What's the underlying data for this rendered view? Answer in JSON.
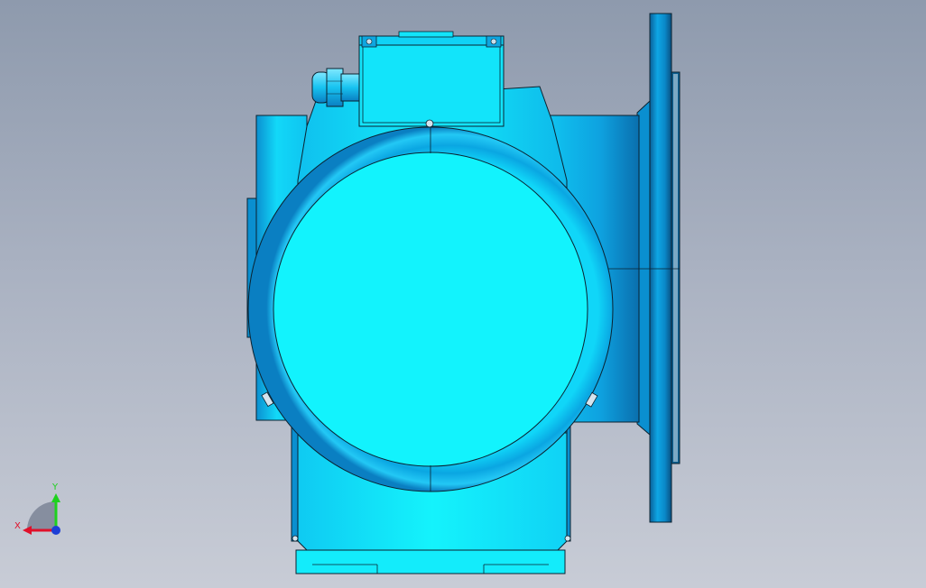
{
  "view": {
    "background_top": "#8e9aad",
    "background_bottom": "#c8ccd6"
  },
  "model": {
    "body_color": "#13f1fb",
    "shade_color": "#0aa8e0",
    "deep_color": "#0a7fc2",
    "outline_color": "#0b2230"
  },
  "triad": {
    "x_label": "X",
    "y_label": "Y",
    "x_color": "#e0102a",
    "y_color": "#1ed11e",
    "z_color": "#1d3fd6"
  }
}
